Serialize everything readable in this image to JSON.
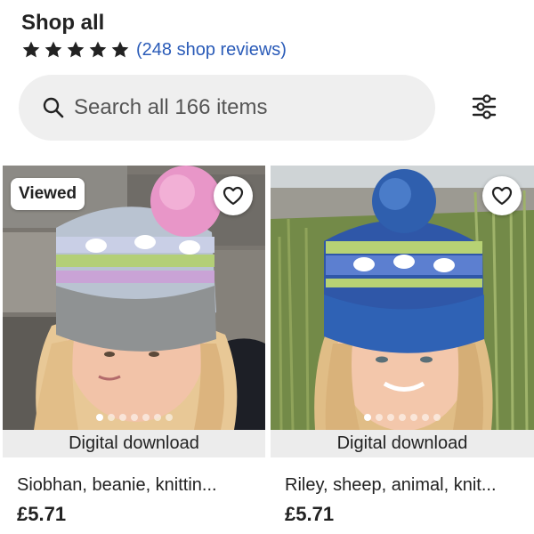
{
  "header": {
    "title": "Shop all",
    "rating_stars": 5,
    "reviews_text": "(248 shop reviews)",
    "star_color": "#222222",
    "link_color": "#2a5bb8"
  },
  "search": {
    "placeholder": "Search all 166 items",
    "icon": "search-icon"
  },
  "filter": {
    "icon": "sliders-icon"
  },
  "listings": [
    {
      "badge": "Viewed",
      "favorite_icon": "heart-outline-icon",
      "image_count": 7,
      "active_image": 1,
      "download_label": "Digital download",
      "title": "Siobhan, beanie, knittin...",
      "price": "£5.71"
    },
    {
      "badge": "",
      "favorite_icon": "heart-outline-icon",
      "image_count": 7,
      "active_image": 1,
      "download_label": "Digital download",
      "title": "Riley, sheep, animal, knit...",
      "price": "£5.71"
    }
  ]
}
